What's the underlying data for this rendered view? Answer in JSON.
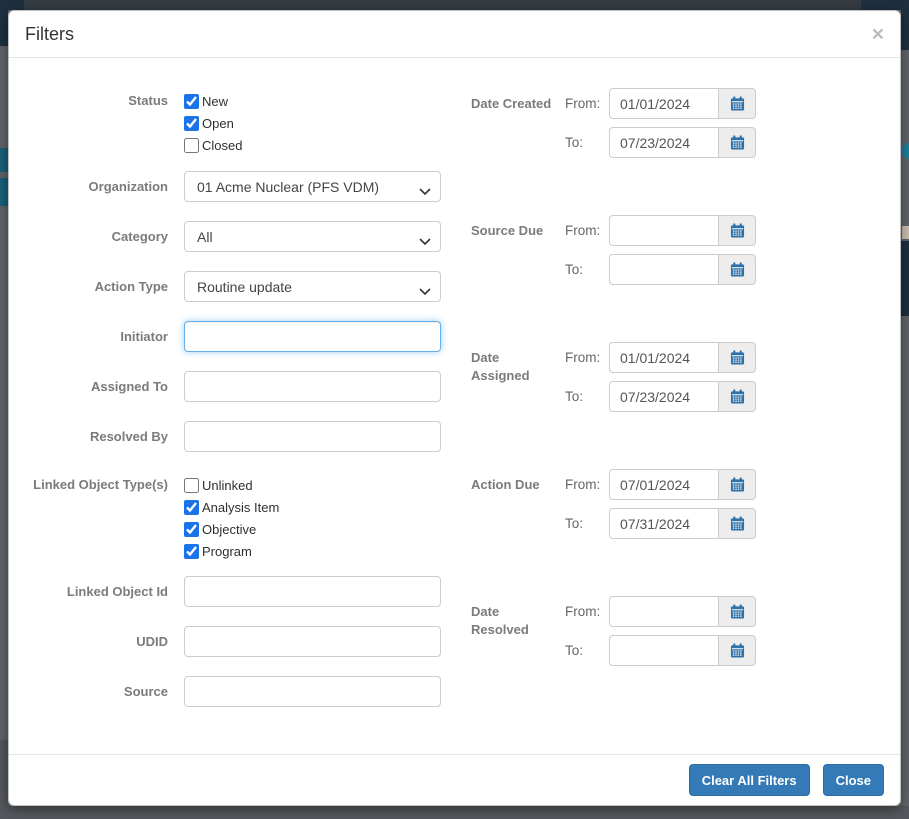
{
  "modal": {
    "title": "Filters",
    "close_icon": "×"
  },
  "left": {
    "status": {
      "label": "Status",
      "options": [
        {
          "label": "New",
          "checked": true
        },
        {
          "label": "Open",
          "checked": true
        },
        {
          "label": "Closed",
          "checked": false
        }
      ]
    },
    "organization": {
      "label": "Organization",
      "value": "01 Acme Nuclear (PFS VDM)"
    },
    "category": {
      "label": "Category",
      "value": "All"
    },
    "action_type": {
      "label": "Action Type",
      "value": "Routine update"
    },
    "initiator": {
      "label": "Initiator",
      "value": ""
    },
    "assigned_to": {
      "label": "Assigned To",
      "value": ""
    },
    "resolved_by": {
      "label": "Resolved By",
      "value": ""
    },
    "linked_object_types": {
      "label": "Linked Object Type(s)",
      "options": [
        {
          "label": "Unlinked",
          "checked": false
        },
        {
          "label": "Analysis Item",
          "checked": true
        },
        {
          "label": "Objective",
          "checked": true
        },
        {
          "label": "Program",
          "checked": true
        }
      ]
    },
    "linked_object_id": {
      "label": "Linked Object Id",
      "value": ""
    },
    "udid": {
      "label": "UDID",
      "value": ""
    },
    "source": {
      "label": "Source",
      "value": ""
    }
  },
  "right": {
    "from_label": "From:",
    "to_label": "To:",
    "sections": [
      {
        "label": "Date Created",
        "from": "01/01/2024",
        "to": "07/23/2024"
      },
      {
        "label": "Source Due",
        "from": "",
        "to": ""
      },
      {
        "label": "Date Assigned",
        "from": "01/01/2024",
        "to": "07/23/2024"
      },
      {
        "label": "Action Due",
        "from": "07/01/2024",
        "to": "07/31/2024"
      },
      {
        "label": "Date Resolved",
        "from": "",
        "to": ""
      }
    ]
  },
  "footer": {
    "clear_label": "Clear All Filters",
    "close_label": "Close"
  },
  "colors": {
    "primary_button": "#337ab7",
    "checkbox_accent": "#1a73e8",
    "focus_border": "#66afe9",
    "calendar_icon": "#2e70a8",
    "backdrop": "#60646a"
  }
}
